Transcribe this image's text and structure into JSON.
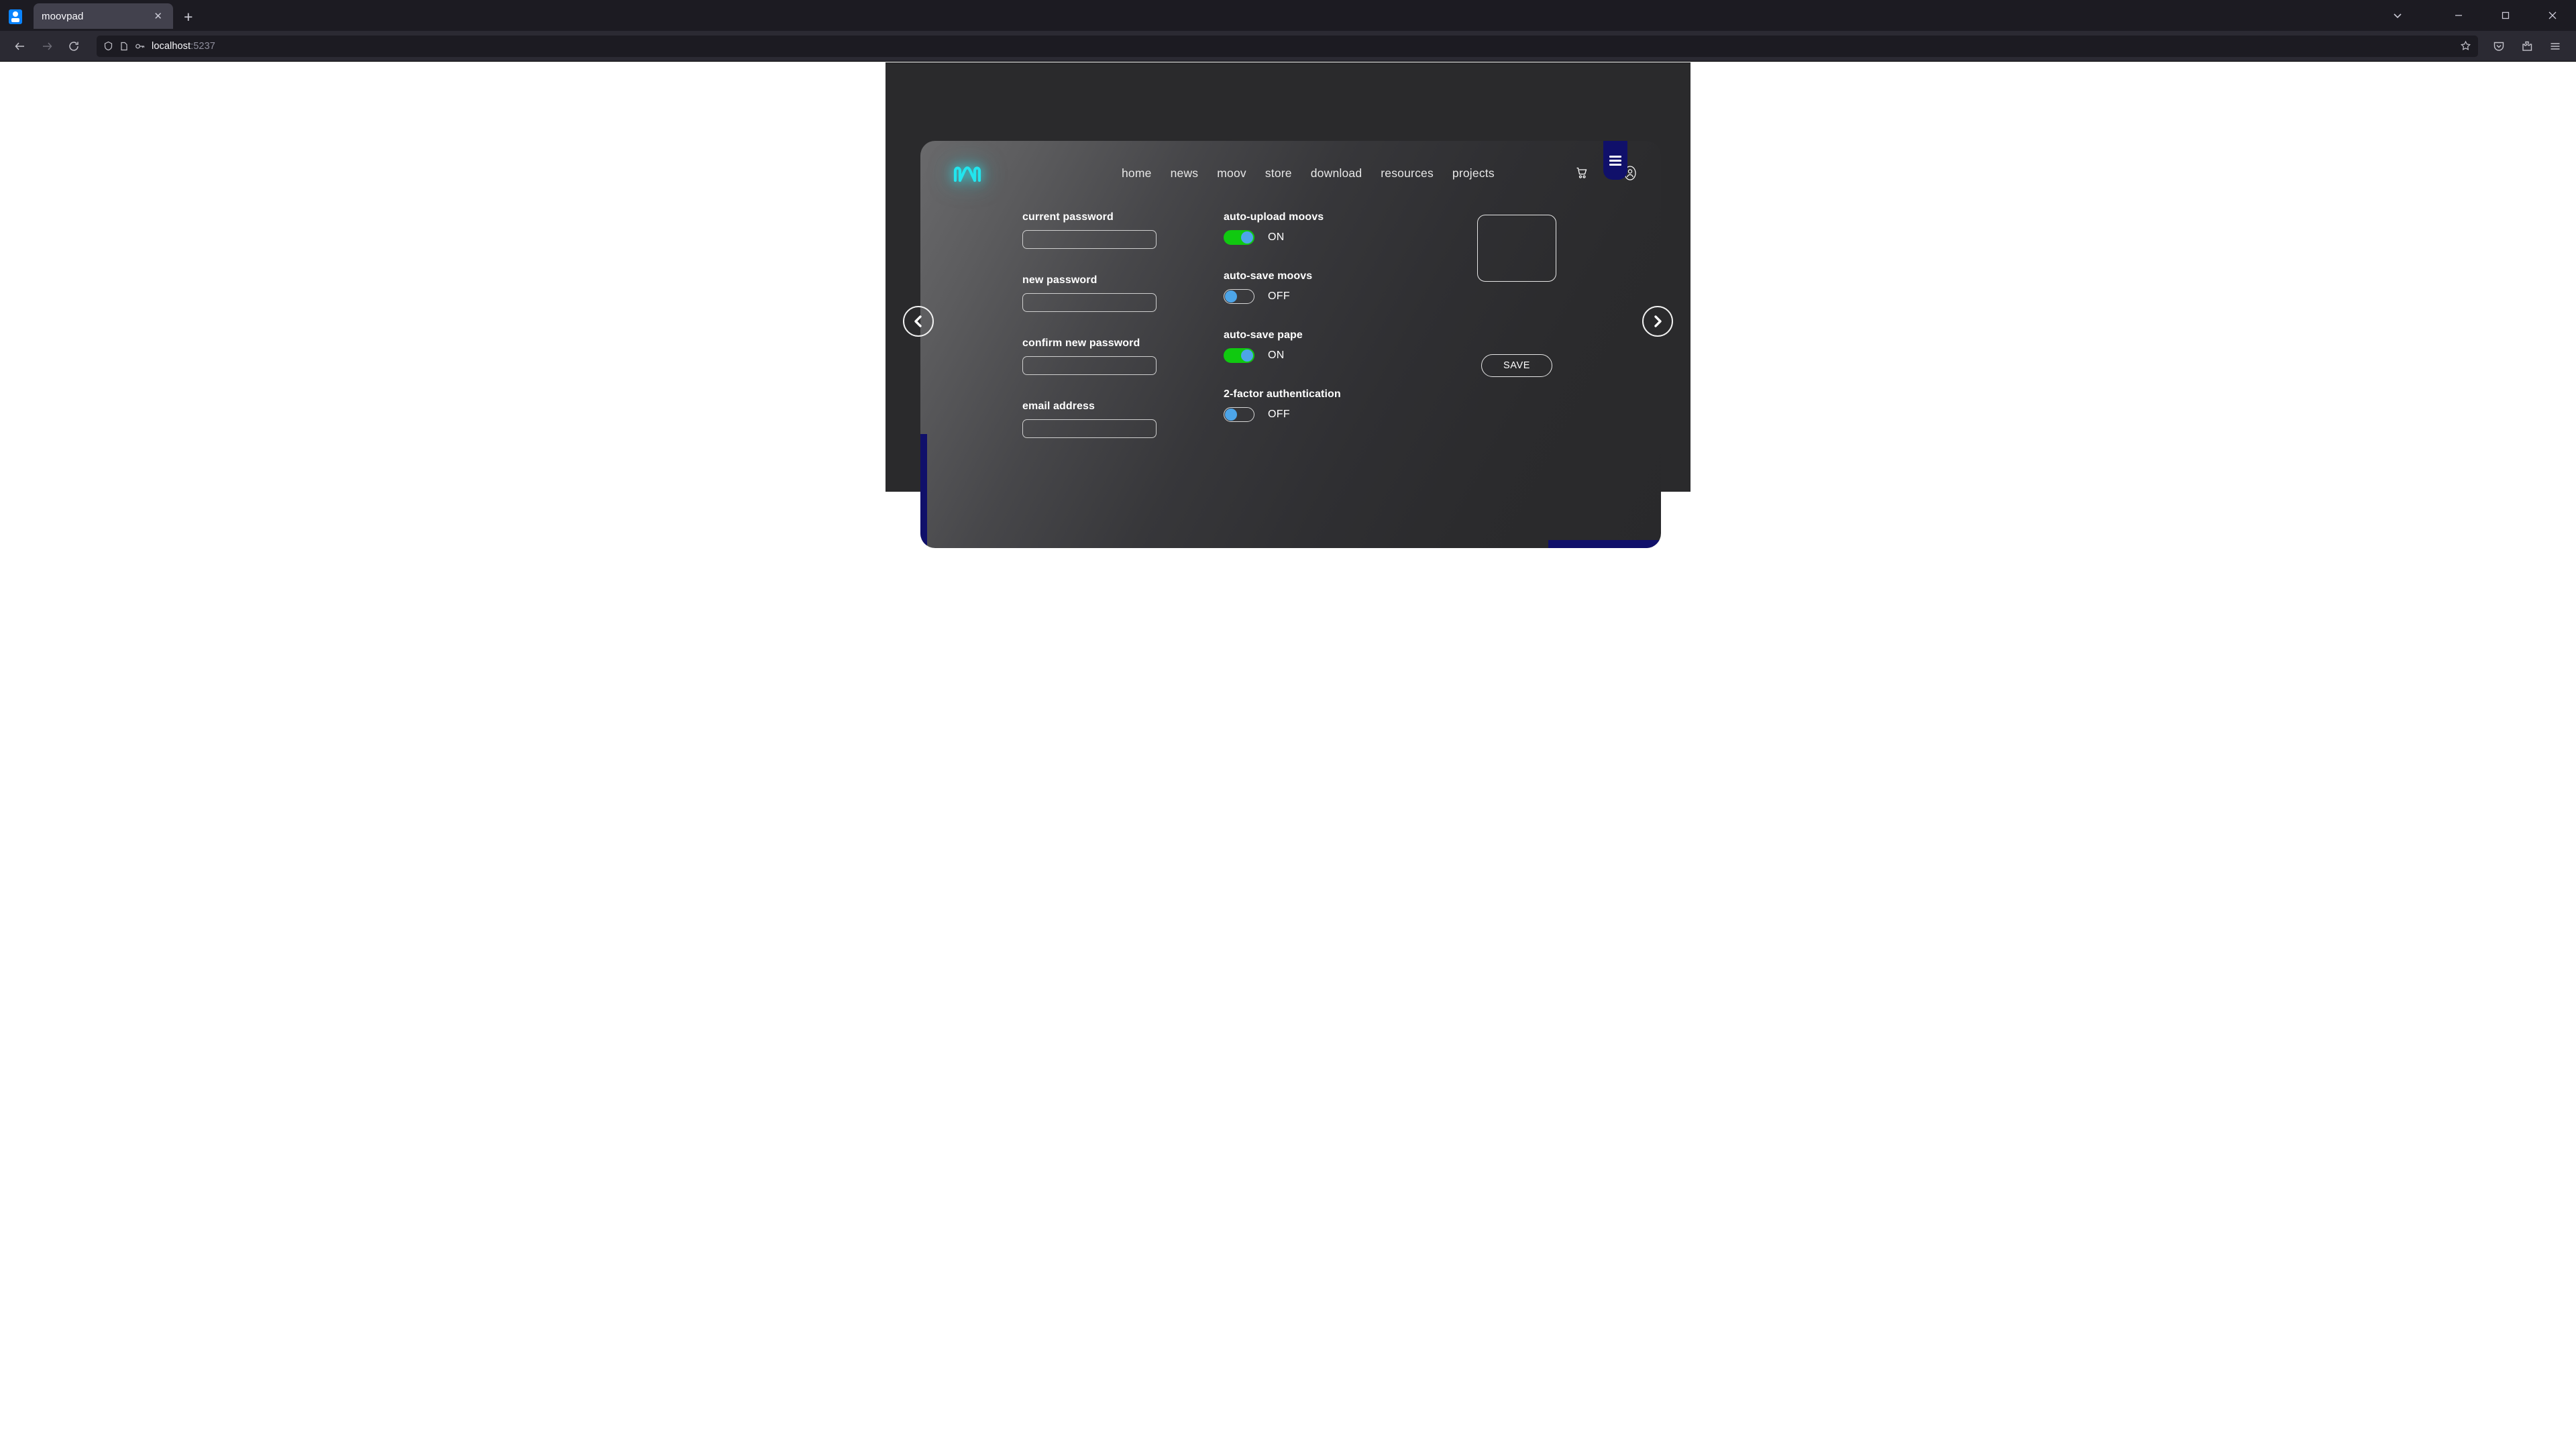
{
  "browser": {
    "tab": {
      "title": "moovpad",
      "close_label": "✕"
    },
    "newtab_label": "+",
    "url": {
      "host": "localhost",
      "port": ":5237"
    },
    "icons": {
      "back": "back-arrow-icon",
      "forward": "forward-arrow-icon",
      "reload": "reload-icon",
      "shield": "shield-icon",
      "page": "page-icon",
      "key": "key-icon",
      "bookmark": "star-icon",
      "pocket": "pocket-save-icon",
      "extensions": "extensions-icon",
      "app_menu": "hamburger-menu-icon",
      "list_tabs": "chevron-down-icon",
      "minimize": "minimize-icon",
      "maximize": "maximize-icon",
      "close": "close-icon"
    }
  },
  "site": {
    "logo": "moov-m-logo",
    "nav": [
      {
        "label": "home"
      },
      {
        "label": "news"
      },
      {
        "label": "moov"
      },
      {
        "label": "store"
      },
      {
        "label": "download"
      },
      {
        "label": "resources"
      },
      {
        "label": "projects"
      }
    ],
    "header_icons": {
      "cart": "shopping-cart-icon",
      "account": "user-account-icon",
      "menu": "hamburger-menu-icon"
    },
    "fields": [
      {
        "label": "current password",
        "value": "",
        "placeholder": ""
      },
      {
        "label": "new password",
        "value": "",
        "placeholder": ""
      },
      {
        "label": "confirm new password",
        "value": "",
        "placeholder": ""
      },
      {
        "label": "email address",
        "value": "",
        "placeholder": ""
      }
    ],
    "toggles": [
      {
        "label": "auto-upload moovs",
        "state": "ON",
        "on": true
      },
      {
        "label": "auto-save moovs",
        "state": "OFF",
        "on": false
      },
      {
        "label": "auto-save pape",
        "state": "ON",
        "on": true
      },
      {
        "label": "2-factor authentication",
        "state": "OFF",
        "on": false
      }
    ],
    "avatar_box": "profile-image-placeholder",
    "save_label": "SAVE",
    "carousel": {
      "prev": "chevron-left-icon",
      "next": "chevron-right-icon"
    }
  },
  "colors": {
    "logo_cyan": "#22e5ee",
    "toggle_on": "#10c910",
    "toggle_knob": "#4da5e8",
    "accent_navy": "#10106a",
    "card_dark": "#2b2b2d"
  }
}
